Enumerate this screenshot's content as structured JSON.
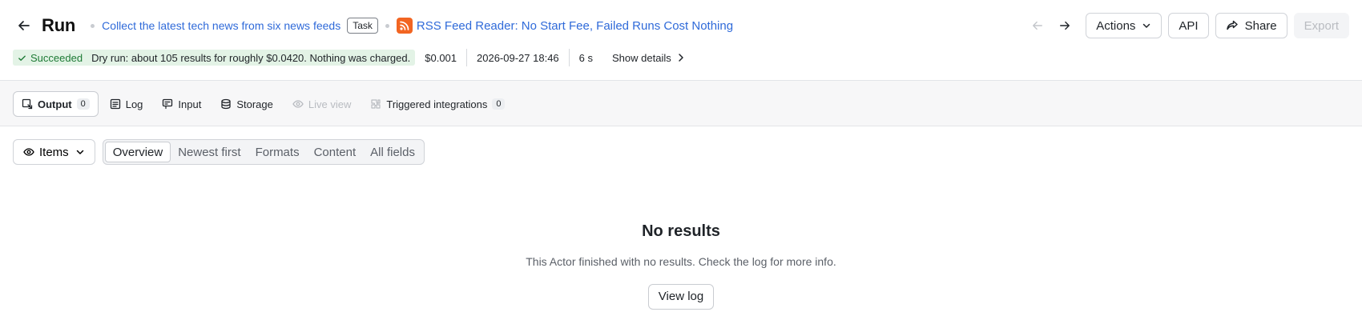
{
  "header": {
    "title": "Run",
    "task_link": "Collect the latest tech news from six news feeds",
    "task_badge": "Task",
    "actor_icon": "rss-icon",
    "actor_link": "RSS Feed Reader: No Start Fee, Failed Runs Cost Nothing",
    "actions": {
      "actions_label": "Actions",
      "api_label": "API",
      "share_label": "Share",
      "export_label": "Export"
    }
  },
  "status": {
    "badge": "Succeeded",
    "note": "Dry run: about 105 results for roughly $0.0420. Nothing was charged.",
    "cost": "$0.001",
    "started": "2026-09-27 18:46",
    "duration": "6 s",
    "show_details": "Show details",
    "colors": {
      "success_bg": "#e3f3e6",
      "success_text": "#1d7a35"
    }
  },
  "tabs": [
    {
      "label": "Output",
      "count": "0",
      "icon": "output-icon",
      "active": true
    },
    {
      "label": "Log",
      "icon": "log-icon"
    },
    {
      "label": "Input",
      "icon": "input-icon"
    },
    {
      "label": "Storage",
      "icon": "storage-icon"
    },
    {
      "label": "Live view",
      "icon": "live-view-icon",
      "disabled": true
    },
    {
      "label": "Triggered integrations",
      "count": "0",
      "icon": "integrations-icon"
    }
  ],
  "toolbar": {
    "items_label": "Items",
    "views": [
      "Overview",
      "Newest first",
      "Formats",
      "Content",
      "All fields"
    ],
    "active_view": "Overview"
  },
  "empty": {
    "title": "No results",
    "text": "This Actor finished with no results. Check the log for more info.",
    "button": "View log"
  },
  "accent_color": "#2f6ad9"
}
